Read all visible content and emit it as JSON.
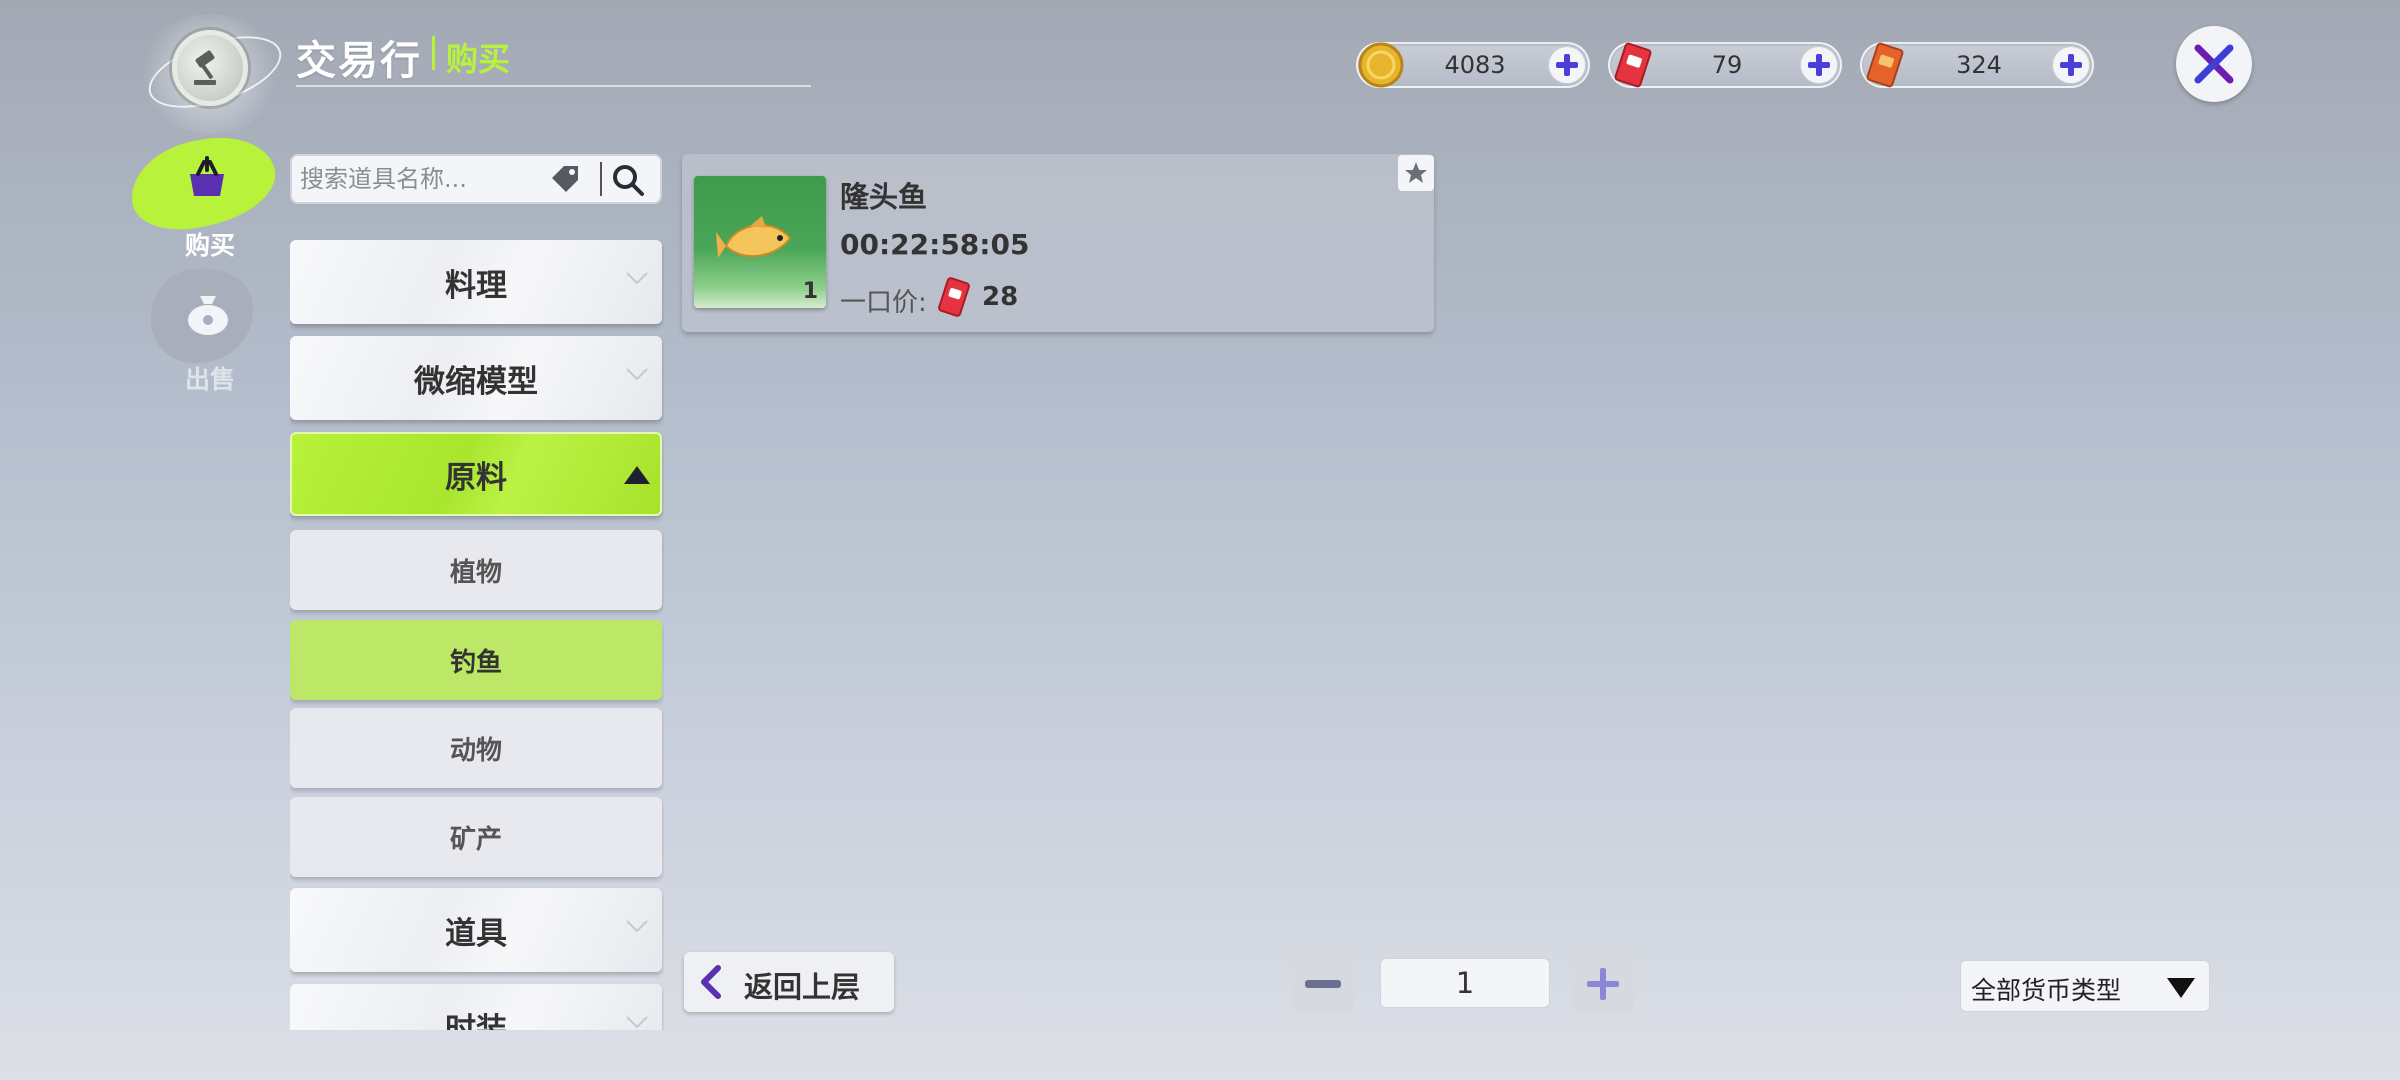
{
  "header": {
    "title": "交易行",
    "subtitle": "购买"
  },
  "currencies": [
    {
      "name": "gold-coin",
      "value": "4083",
      "color": "#e7b52d"
    },
    {
      "name": "red-ticket",
      "value": "79",
      "color": "#e5343f"
    },
    {
      "name": "orange-ticket",
      "value": "324",
      "color": "#e5622a"
    }
  ],
  "side_tabs": {
    "buy_label": "购买",
    "sell_label": "出售"
  },
  "search": {
    "placeholder": "搜索道具名称..."
  },
  "categories": {
    "cooking": "料理",
    "miniature": "微缩模型",
    "materials": "原料",
    "plants": "植物",
    "fishing": "钓鱼",
    "animals": "动物",
    "minerals": "矿产",
    "props": "道具",
    "fashion": "时装"
  },
  "item": {
    "name": "隆头鱼",
    "time_left": "00:22:58:05",
    "quantity": "1",
    "price_label": "一口价:",
    "price": "28"
  },
  "footer": {
    "back_label": "返回上层",
    "page": "1",
    "currency_filter": "全部货币类型"
  },
  "colors": {
    "accent": "#b9f23a",
    "close_x": "#6a1fb0",
    "plus": "#4a3fd8"
  }
}
